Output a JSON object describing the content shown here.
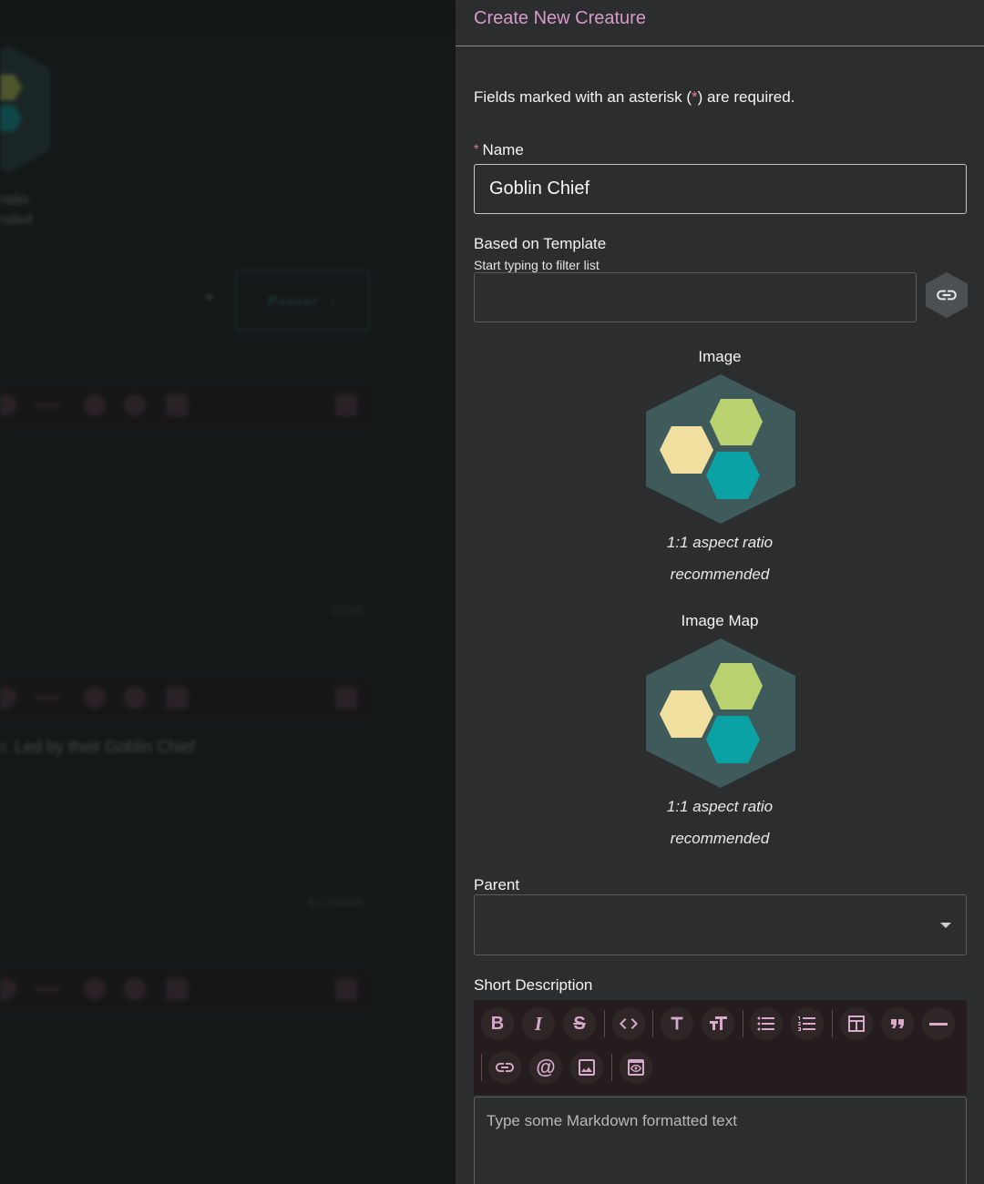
{
  "background": {
    "ratio_text_1": "ratio",
    "ratio_text_2": "nded",
    "parent_button_label": "Parent",
    "counter_1": "0/100",
    "counter_2": "61/10000",
    "description_snippet": "e. Led by their Goblin Chief"
  },
  "dialog": {
    "title": "Create New Creature",
    "required_note_prefix": "Fields marked with an asterisk (",
    "required_note_asterisk": "*",
    "required_note_suffix": ") are required.",
    "name": {
      "asterisk": "*",
      "label": "Name",
      "value": "Goblin Chief"
    },
    "template": {
      "label": "Based on Template",
      "hint": "Start typing to filter list",
      "value": "",
      "link_icon": "link-icon"
    },
    "image": {
      "label": "Image",
      "note_line1": "1:1 aspect ratio",
      "note_line2": "recommended"
    },
    "image_map": {
      "label": "Image Map",
      "note_line1": "1:1 aspect ratio",
      "note_line2": "recommended"
    },
    "parent": {
      "label": "Parent",
      "value": ""
    },
    "short_description": {
      "label": "Short Description",
      "placeholder": "Type some Markdown formatted text",
      "toolbar": [
        "bold-icon",
        "italic-icon",
        "strikethrough-icon",
        "code-icon",
        "heading-icon",
        "heading-size-icon",
        "bullet-list-icon",
        "numbered-list-icon",
        "table-icon",
        "quote-icon",
        "horizontal-rule-icon",
        "link-icon",
        "mention-icon",
        "image-icon",
        "preview-icon"
      ]
    },
    "colors": {
      "accent": "#d79bc9",
      "panel_bg": "#2b2d2e",
      "hex_bg": "#3e5a5a",
      "hex_green": "#b9d26f",
      "hex_cream": "#f1dfa0",
      "hex_teal": "#0aa2a4"
    }
  }
}
